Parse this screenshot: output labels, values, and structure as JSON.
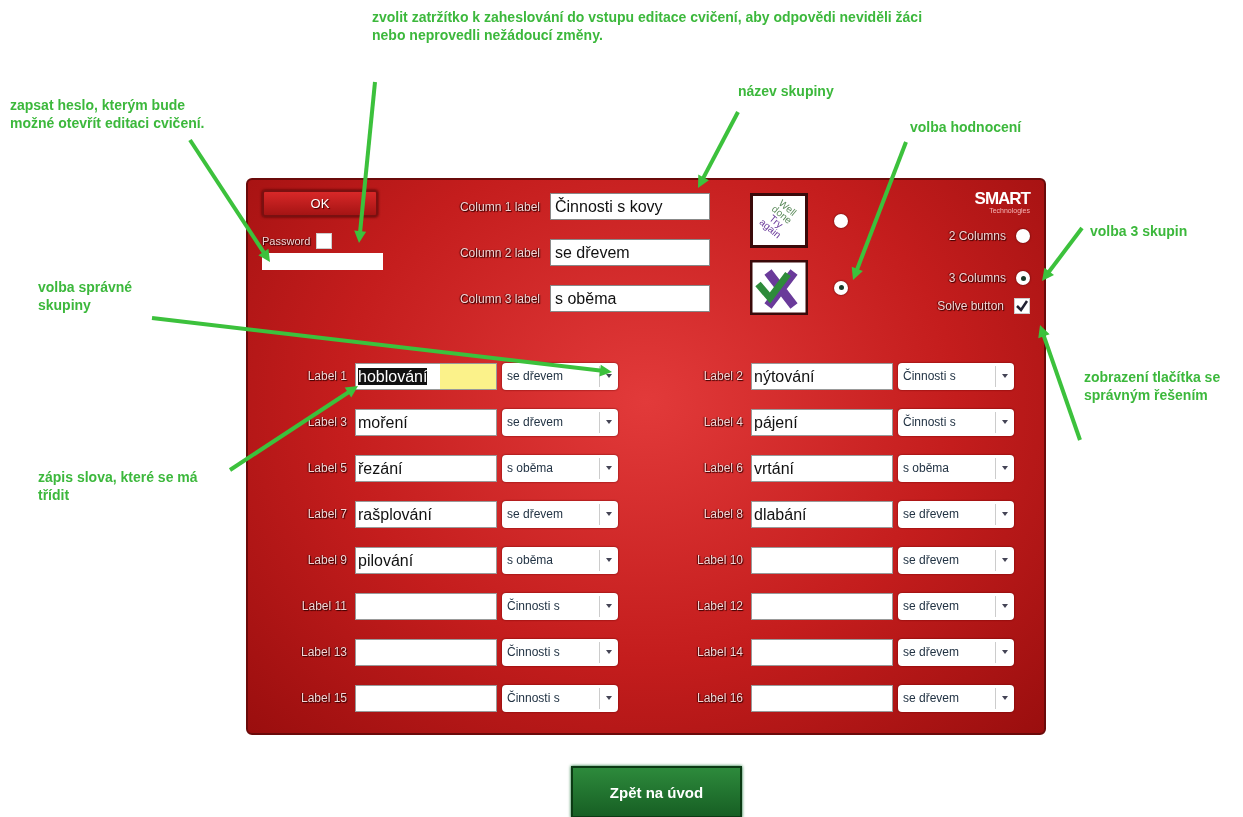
{
  "annotations": [
    {
      "text": "zvolit zatržítko k zaheslování do vstupu editace cvičení, aby odpovědi neviděli žáci nebo neprovedli nežádoucí změny."
    },
    {
      "text": "název skupiny"
    },
    {
      "text": "zapsat heslo, kterým bude možné otevřít editaci cvičení."
    },
    {
      "text": "volba hodnocení"
    },
    {
      "text": "volba 3 skupin"
    },
    {
      "text": "volba správné skupiny"
    },
    {
      "text": "zobrazení tlačítka se správným řešením"
    },
    {
      "text": "zápis slova, které se má třídit"
    }
  ],
  "panel": {
    "ok_button": "OK",
    "password": {
      "label": "Password",
      "checked": false
    },
    "column_labels": [
      {
        "label": "Column 1 label",
        "value": "Činnosti s kovy"
      },
      {
        "label": "Column 2 label",
        "value": "se dřevem"
      },
      {
        "label": "Column 3 label",
        "value": "s oběma"
      }
    ],
    "feedback_styles": [
      {
        "kind": "text",
        "selected": false,
        "words": [
          "Well",
          "done",
          "Try",
          "again"
        ]
      },
      {
        "kind": "icons",
        "selected": true
      }
    ],
    "logo": {
      "name": "SMART",
      "tagline": "Technologies"
    },
    "column_options": [
      {
        "label": "2 Columns",
        "selected": false
      },
      {
        "label": "3 Columns",
        "selected": true
      }
    ],
    "solve_button": {
      "label": "Solve button",
      "checked": true
    },
    "items": [
      {
        "label": "Label 1",
        "value": "hoblování",
        "text_selected": true,
        "group": "se dřevem"
      },
      {
        "label": "Label 2",
        "value": "nýtování",
        "text_selected": false,
        "group": "Činnosti s"
      },
      {
        "label": "Label 3",
        "value": "moření",
        "text_selected": false,
        "group": "se dřevem"
      },
      {
        "label": "Label 4",
        "value": "pájení",
        "text_selected": false,
        "group": "Činnosti s"
      },
      {
        "label": "Label 5",
        "value": "řezání",
        "text_selected": false,
        "group": "s oběma"
      },
      {
        "label": "Label 6",
        "value": "vrtání",
        "text_selected": false,
        "group": "s oběma"
      },
      {
        "label": "Label 7",
        "value": "rašplování",
        "text_selected": false,
        "group": "se dřevem"
      },
      {
        "label": "Label 8",
        "value": "dlabání",
        "text_selected": false,
        "group": "se dřevem"
      },
      {
        "label": "Label 9",
        "value": "pilování",
        "text_selected": false,
        "group": "s oběma"
      },
      {
        "label": "Label 10",
        "text_selected": false,
        "group": "se dřevem"
      },
      {
        "label": "Label 11",
        "text_selected": false,
        "group": "Činnosti s"
      },
      {
        "label": "Label 12",
        "text_selected": false,
        "group": "se dřevem"
      },
      {
        "label": "Label 13",
        "text_selected": false,
        "group": "Činnosti s"
      },
      {
        "label": "Label 14",
        "text_selected": false,
        "group": "se dřevem"
      },
      {
        "label": "Label 15",
        "text_selected": false,
        "group": "Činnosti s"
      },
      {
        "label": "Label 16",
        "text_selected": false,
        "group": "se dřevem"
      }
    ]
  },
  "back_button": "Zpět na úvod"
}
